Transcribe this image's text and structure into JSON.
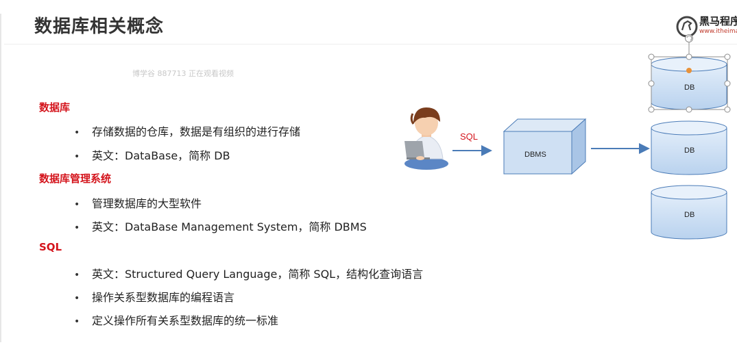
{
  "slide": {
    "title": "数据库相关概念",
    "watermark": "博学谷 887713 正在观看视频"
  },
  "logo": {
    "name_cn": "黑马程序员",
    "url": "www.itheima.com"
  },
  "sections": [
    {
      "heading": "数据库",
      "bullets": [
        "存储数据的仓库，数据是有组织的进行存储",
        "英文：DataBase，简称 DB"
      ]
    },
    {
      "heading": "数据库管理系统",
      "bullets": [
        "管理数据库的大型软件",
        "英文：DataBase Management System，简称 DBMS"
      ]
    },
    {
      "heading": "SQL",
      "bullets": [
        "英文：Structured Query Language，简称 SQL，结构化查询语言",
        "操作关系型数据库的编程语言",
        "定义操作所有关系型数据库的统一标准"
      ]
    }
  ],
  "bullet_glyph": "•",
  "diagram": {
    "sql_label": "SQL",
    "dbms_label": "DBMS",
    "db_labels": [
      "DB",
      "DB",
      "DB"
    ],
    "colors": {
      "accent_red": "#d4141c",
      "arrow": "#4a7bb7",
      "box_fill": "#cfe0f3",
      "box_stroke": "#4a7bb7",
      "selection": "#8c8c8c",
      "rotate_handle": "#e8923a"
    }
  }
}
